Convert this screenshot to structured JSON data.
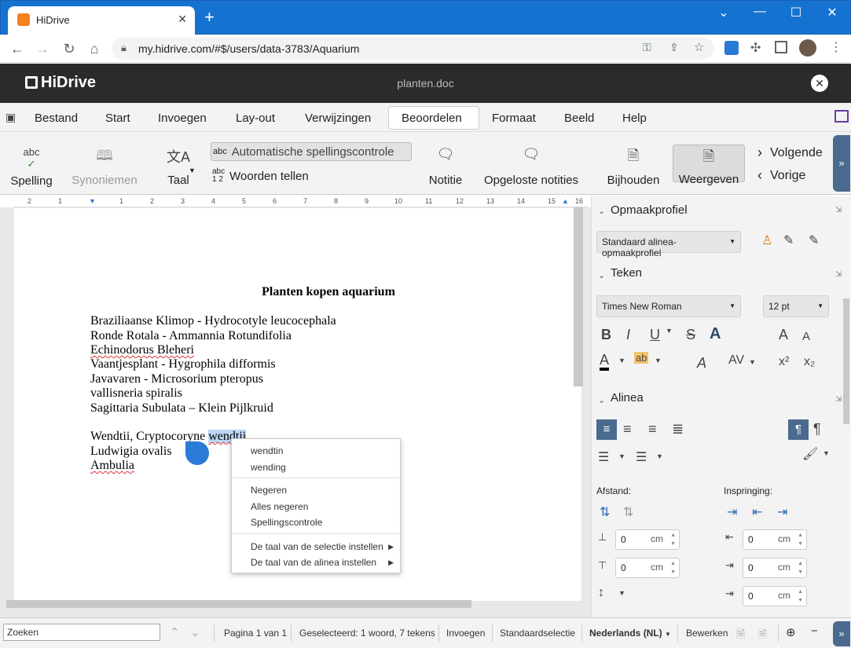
{
  "browser": {
    "tab_title": "HiDrive",
    "url": "my.hidrive.com/#$/users/data-3783/Aquarium"
  },
  "app": {
    "logo": "HiDrive",
    "doc_title": "planten.doc"
  },
  "menubar": {
    "items": [
      "Bestand",
      "Start",
      "Invoegen",
      "Lay-out",
      "Verwijzingen",
      "Beoordelen",
      "Formaat",
      "Beeld",
      "Help"
    ],
    "active": "Beoordelen"
  },
  "ribbon": {
    "spelling": "Spelling",
    "synonyms": "Synoniemen",
    "language": "Taal",
    "auto_spell": "Automatische spellingscontrole",
    "word_count": "Woorden tellen",
    "note": "Notitie",
    "resolved_notes": "Opgeloste notities",
    "track": "Bijhouden",
    "view": "Weergeven",
    "next": "Volgende",
    "prev": "Vorige"
  },
  "ruler": [
    "2",
    "1",
    "1",
    "1",
    "2",
    "3",
    "4",
    "5",
    "6",
    "7",
    "8",
    "9",
    "10",
    "11",
    "12",
    "13",
    "14",
    "15",
    "16"
  ],
  "document": {
    "title": "Planten kopen aquarium",
    "lines": [
      "Braziliaanse Klimop - Hydrocotyle leucocephala",
      "Ronde Rotala - Ammannia Rotundifolia",
      "Echinodorus Bleheri",
      "Vaantjesplant - Hygrophila difformis",
      "Javavaren - Microsorium pteropus",
      "vallisneria spiralis",
      "Sagittaria Subulata – Klein Pijlkruid"
    ],
    "line_w1": "Wendtii, Cryptocoryne ",
    "line_w2": "wendtii",
    "line_l": "Ludwigia ovalis",
    "line_a": "Ambulia"
  },
  "context_menu": {
    "suggestions": [
      "wendtin",
      "wending"
    ],
    "actions": [
      "Negeren",
      "Alles negeren",
      "Spellingscontrole"
    ],
    "language": [
      "De taal van de selectie instellen",
      "De taal van de alinea instellen"
    ]
  },
  "sidebar": {
    "style_header": "Opmaakprofiel",
    "style_value": "Standaard alinea-opmaakprofiel",
    "font_header": "Teken",
    "font_value": "Times New Roman",
    "size_value": "12 pt",
    "para_header": "Alinea",
    "spacing_label": "Afstand:",
    "indent_label": "Inspringing:",
    "spin_value": "0",
    "spin_unit": "cm",
    "btn_bold": "B",
    "btn_italic": "I",
    "btn_underline": "U",
    "btn_strike": "S",
    "btn_outline": "A",
    "btn_grow": "A",
    "btn_shrink": "A",
    "btn_fontcolor": "A",
    "btn_highlight": "ab",
    "btn_clear": "A",
    "btn_spacing": "AV",
    "btn_sup": "x²",
    "btn_sub": "x₂"
  },
  "status": {
    "search_placeholder": "Zoeken",
    "page": "Pagina 1 van 1",
    "selection": "Geselecteerd: 1 woord, 7 tekens",
    "insert": "Invoegen",
    "selmode": "Standaardselectie",
    "language": "Nederlands (NL)",
    "edit": "Bewerken"
  }
}
